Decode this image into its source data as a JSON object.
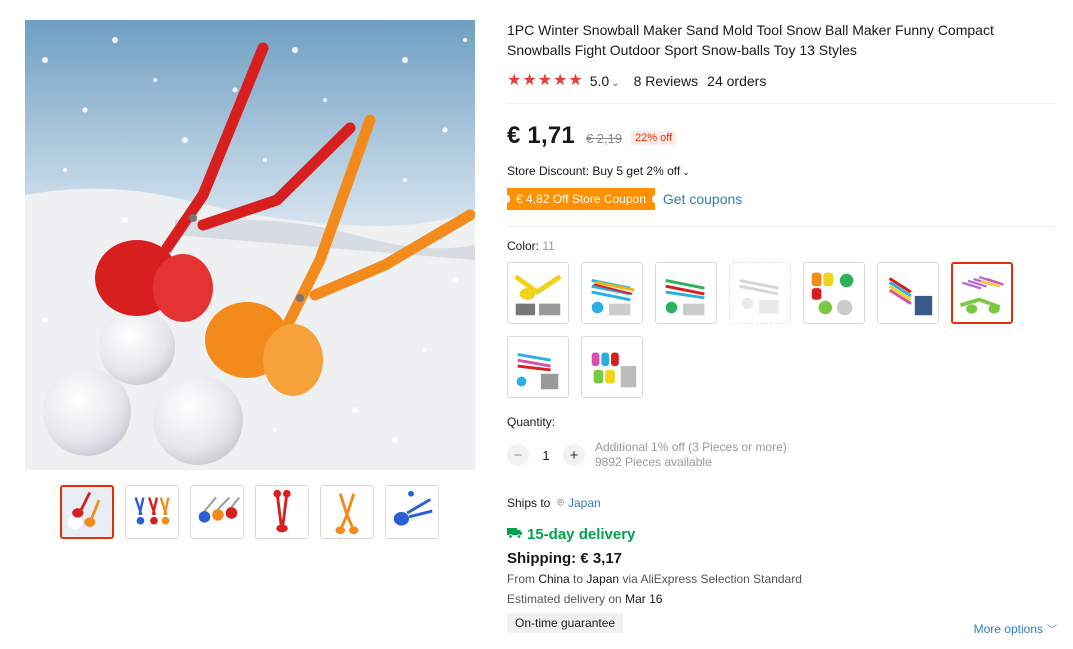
{
  "product": {
    "title": "1PC Winter Snowball Maker Sand Mold Tool Snow Ball Maker Funny Compact Snowballs Fight Outdoor Sport Snow-balls Toy 13 Styles",
    "rating": "5.0",
    "stars": 5,
    "reviews": "8 Reviews",
    "orders": "24 orders"
  },
  "price": {
    "current": "€ 1,71",
    "original": "€ 2,19",
    "discount": "22% off"
  },
  "promotions": {
    "store_discount": "Store Discount: Buy 5 get 2% off",
    "coupon": "€ 4,82 Off Store Coupon",
    "get_coupons": "Get coupons"
  },
  "color": {
    "label": "Color:",
    "count": "11",
    "selected_index": 6
  },
  "quantity": {
    "label": "Quantity:",
    "value": "1",
    "minus": "−",
    "plus": "+",
    "additional": "Additional 1% off (3 Pieces or more)",
    "available": "9892 Pieces available"
  },
  "shipping": {
    "ships_to_label": "Ships to",
    "country": "Japan",
    "delivery": "15-day delivery",
    "cost": "Shipping: € 3,17",
    "from_prefix": "From",
    "from_country": "China",
    "to_word": "to",
    "to_country": "Japan",
    "via": "via AliExpress Selection Standard",
    "estimated_prefix": "Estimated delivery on",
    "estimated_date": "Mar 16",
    "guarantee": "On-time guarantee",
    "more_options": "More options"
  },
  "icons": {
    "star": "star-icon",
    "caret": "chevron-down-icon",
    "pin": "location-pin-icon",
    "truck": "truck-icon"
  },
  "colors": {
    "accent_red": "#e62e04",
    "star_red": "#ec3b3b",
    "coupon_orange": "#ff9000",
    "link_blue": "#2e7fb8",
    "delivery_green": "#00a34a"
  }
}
